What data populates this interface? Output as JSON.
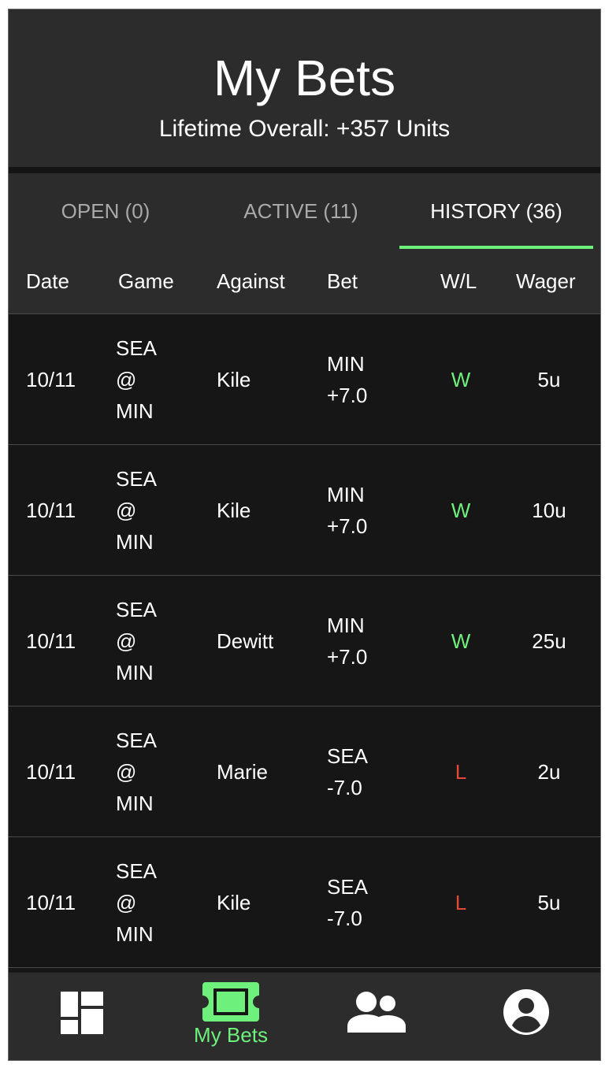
{
  "header": {
    "title": "My Bets",
    "subtitle": "Lifetime Overall: +357 Units"
  },
  "tabs": [
    {
      "label": "OPEN (0)",
      "active": false
    },
    {
      "label": "ACTIVE (11)",
      "active": false
    },
    {
      "label": "HISTORY (36)",
      "active": true
    }
  ],
  "columns": [
    "Date",
    "Game",
    "Against",
    "Bet",
    "W/L",
    "Wager"
  ],
  "rows": [
    {
      "date": "10/11",
      "game": [
        "SEA",
        "@",
        "MIN"
      ],
      "against": "Kile",
      "bet": [
        "MIN",
        "+7.0"
      ],
      "result": "W",
      "wager": "5u"
    },
    {
      "date": "10/11",
      "game": [
        "SEA",
        "@",
        "MIN"
      ],
      "against": "Kile",
      "bet": [
        "MIN",
        "+7.0"
      ],
      "result": "W",
      "wager": "10u"
    },
    {
      "date": "10/11",
      "game": [
        "SEA",
        "@",
        "MIN"
      ],
      "against": "Dewitt",
      "bet": [
        "MIN",
        "+7.0"
      ],
      "result": "W",
      "wager": "25u"
    },
    {
      "date": "10/11",
      "game": [
        "SEA",
        "@",
        "MIN"
      ],
      "against": "Marie",
      "bet": [
        "SEA",
        "-7.0"
      ],
      "result": "L",
      "wager": "2u"
    },
    {
      "date": "10/11",
      "game": [
        "SEA",
        "@",
        "MIN"
      ],
      "against": "Kile",
      "bet": [
        "SEA",
        "-7.0"
      ],
      "result": "L",
      "wager": "5u"
    }
  ],
  "nav": {
    "items": [
      {
        "icon": "dashboard-icon",
        "label": ""
      },
      {
        "icon": "ticket-icon",
        "label": "My Bets",
        "active": true
      },
      {
        "icon": "friends-icon",
        "label": ""
      },
      {
        "icon": "profile-icon",
        "label": ""
      }
    ]
  },
  "colors": {
    "accent": "#6ef07d",
    "loss": "#e24a35",
    "background": "#161616",
    "panel": "#2c2c2c"
  }
}
